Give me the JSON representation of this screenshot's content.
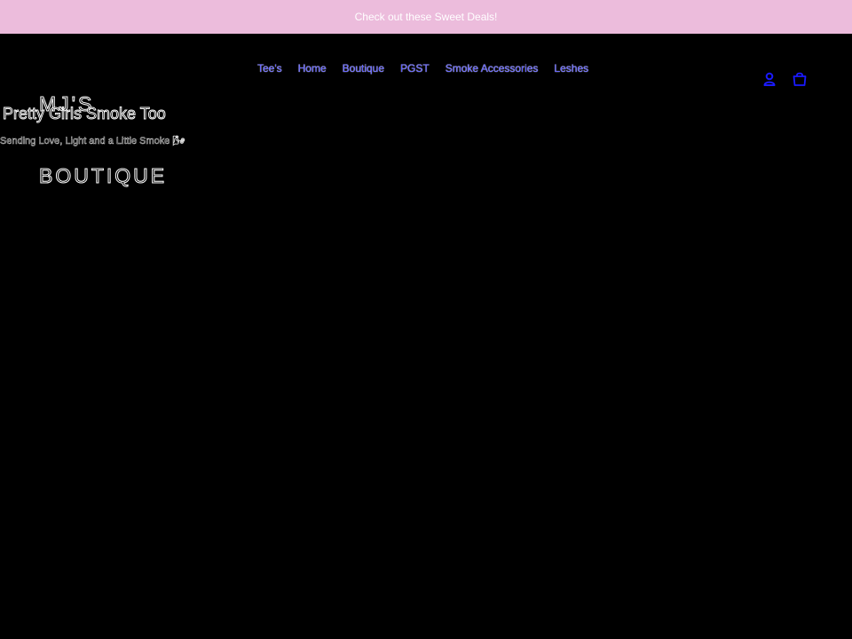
{
  "announcement": {
    "text": "Check out these Sweet Deals!",
    "background_color": "#ecbcdc"
  },
  "header": {
    "logo": {
      "line1": "MJ'S",
      "line2": "BOUTIQUE"
    },
    "nav": [
      {
        "label": "Tee's"
      },
      {
        "label": "Home"
      },
      {
        "label": "Boutique"
      },
      {
        "label": "PGST"
      },
      {
        "label": "Smoke Accessories"
      },
      {
        "label": "Leshes"
      }
    ],
    "icons": [
      {
        "name": "account-icon"
      },
      {
        "name": "cart-icon"
      }
    ],
    "nav_link_color": "#5a5aff",
    "icon_color": "#1a1aff"
  },
  "main": {
    "title": "Pretty Girls Smoke Too",
    "tagline": "Sending Love, Light and a Little Smoke 🌬"
  }
}
